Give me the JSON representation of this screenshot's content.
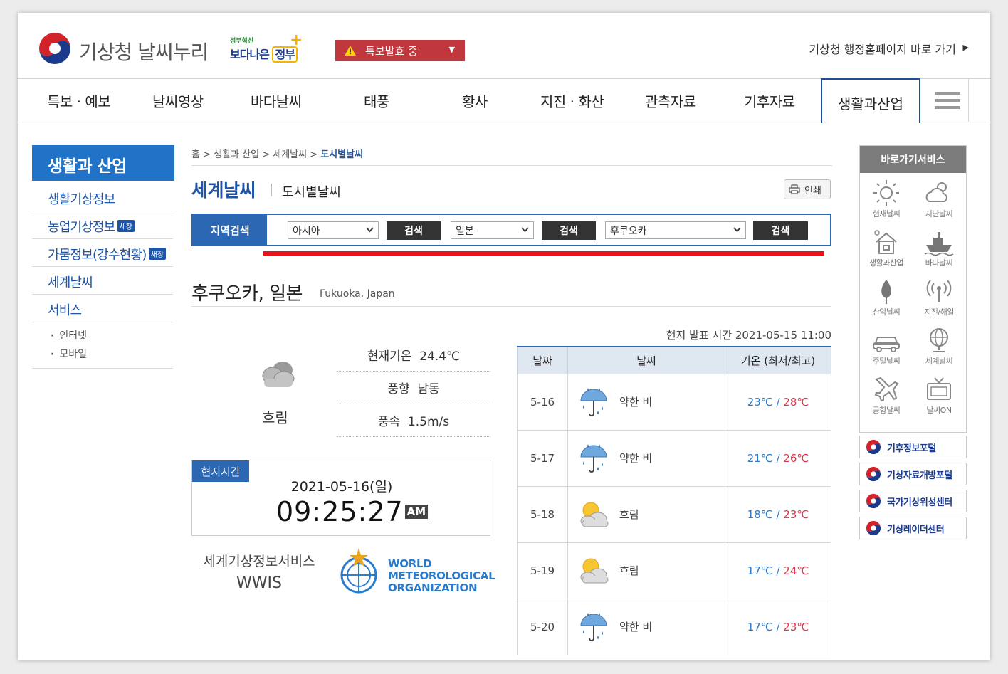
{
  "header": {
    "logo_text": "기상청 날씨누리",
    "gov_small": "정부혁신",
    "gov_big_1": "보다나은",
    "gov_big_2": "정부",
    "alert_label": "특보발효 중",
    "admin_link": "기상청 행정홈페이지 바로 가기"
  },
  "nav": {
    "items": [
      "특보 · 예보",
      "날씨영상",
      "바다날씨",
      "태풍",
      "황사",
      "지진 · 화산",
      "관측자료",
      "기후자료",
      "생활과산업"
    ]
  },
  "sidebar": {
    "title": "생활과 산업",
    "items": [
      {
        "label": "생활기상정보",
        "badge": ""
      },
      {
        "label": "농업기상정보",
        "badge": "새창"
      },
      {
        "label": "가뭄정보(강수현황)",
        "badge": "새창"
      },
      {
        "label": "세계날씨",
        "badge": ""
      },
      {
        "label": "서비스",
        "badge": ""
      }
    ],
    "sub_items": [
      "인터넷",
      "모바일"
    ]
  },
  "breadcrumb": {
    "home": "홈",
    "level1": "생활과 산업",
    "level2": "세계날씨",
    "current": "도시별날씨"
  },
  "page": {
    "title": "세계날씨",
    "subtitle": "도시별날씨",
    "print_label": "인쇄"
  },
  "search": {
    "label": "지역검색",
    "region": "아시아",
    "country": "일본",
    "city": "후쿠오카",
    "button_label": "검색"
  },
  "city": {
    "name": "후쿠오카, 일본",
    "name_en": "Fukuoka, Japan"
  },
  "current": {
    "condition": "흐림",
    "temp_label": "현재기온",
    "temp_value": "24.4℃",
    "wind_dir_label": "풍향",
    "wind_dir_value": "남동",
    "wind_speed_label": "풍속",
    "wind_speed_value": "1.5m/s"
  },
  "local_time": {
    "tag": "현지시간",
    "date": "2021-05-16(일)",
    "clock": "09:25:27",
    "ampm": "AM"
  },
  "wwis": {
    "label_ko": "세계기상정보서비스",
    "label_en": "WWIS",
    "wmo_line1": "WORLD",
    "wmo_line2": "METEOROLOGICAL",
    "wmo_line3": "ORGANIZATION"
  },
  "forecast": {
    "issue_time": "현지 발표 시간 2021-05-15 11:00",
    "headers": [
      "날짜",
      "날씨",
      "기온 (최저/최고)"
    ],
    "rows": [
      {
        "date": "5-16",
        "icon": "umbrella-rain-icon",
        "weather": "약한 비",
        "min": "23℃",
        "sep": " / ",
        "max": "28℃"
      },
      {
        "date": "5-17",
        "icon": "umbrella-rain-icon",
        "weather": "약한 비",
        "min": "21℃",
        "sep": " / ",
        "max": "26℃"
      },
      {
        "date": "5-18",
        "icon": "sun-cloud-icon",
        "weather": "흐림",
        "min": "18℃",
        "sep": " / ",
        "max": "23℃"
      },
      {
        "date": "5-19",
        "icon": "sun-cloud-icon",
        "weather": "흐림",
        "min": "17℃",
        "sep": " / ",
        "max": "24℃"
      },
      {
        "date": "5-20",
        "icon": "umbrella-rain-icon",
        "weather": "약한 비",
        "min": "17℃",
        "sep": " / ",
        "max": "23℃"
      }
    ]
  },
  "quick": {
    "title": "바로가기서비스",
    "items": [
      {
        "label": "현재날씨",
        "icon": "sun-icon"
      },
      {
        "label": "지난날씨",
        "icon": "cloud-sun-icon"
      },
      {
        "label": "생활과산업",
        "icon": "house-icon"
      },
      {
        "label": "바다날씨",
        "icon": "ship-icon"
      },
      {
        "label": "산악날씨",
        "icon": "mountain-tree-icon"
      },
      {
        "label": "지진/해일",
        "icon": "antenna-icon"
      },
      {
        "label": "주말날씨",
        "icon": "car-icon"
      },
      {
        "label": "세계날씨",
        "icon": "globe-icon"
      },
      {
        "label": "공항날씨",
        "icon": "airplane-icon"
      },
      {
        "label": "날씨ON",
        "icon": "tv-icon"
      }
    ]
  },
  "portals": [
    "기후정보포털",
    "기상자료개방포털",
    "국가기상위성센터",
    "기상레이더센터"
  ],
  "colors": {
    "primary": "#2173c7",
    "nav_active_border": "#1f4e96",
    "alert": "#c0373e",
    "red_line": "#e8141c",
    "temp_min": "#2a7bcc",
    "temp_max": "#e0354a"
  }
}
